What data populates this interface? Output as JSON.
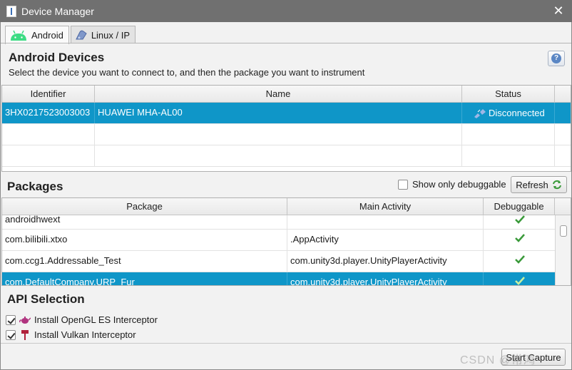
{
  "window": {
    "title": "Device Manager",
    "close_symbol": "✕"
  },
  "tabs": [
    {
      "label": "Android",
      "icon": "android-icon"
    },
    {
      "label": "Linux / IP",
      "icon": "linux-ip-icon"
    }
  ],
  "devices": {
    "title": "Android Devices",
    "subtitle": "Select the device you want to connect to, and then the package you want to instrument",
    "help_label": "?",
    "columns": [
      "Identifier",
      "Name",
      "Status"
    ],
    "rows": [
      {
        "identifier": "3HX0217523003003",
        "name": "HUAWEI MHA-AL00",
        "status": "Disconnected"
      }
    ]
  },
  "packages": {
    "title": "Packages",
    "show_debuggable_label": "Show only debuggable",
    "show_debuggable_checked": false,
    "refresh_label": "Refresh",
    "columns": [
      "Package",
      "Main Activity",
      "Debuggable"
    ],
    "rows": [
      {
        "package": "androidhwext",
        "activity": "",
        "debuggable": true
      },
      {
        "package": "com.bilibili.xtxo",
        "activity": ".AppActivity",
        "debuggable": true
      },
      {
        "package": "com.ccg1.Addressable_Test",
        "activity": "com.unity3d.player.UnityPlayerActivity",
        "debuggable": true
      },
      {
        "package": "com.DefaultCompany.URP_Fur",
        "activity": "com.unity3d.player.UnityPlayerActivity",
        "debuggable": true
      }
    ]
  },
  "api": {
    "title": "API Selection",
    "options": [
      {
        "label": "Install OpenGL ES Interceptor",
        "checked": true,
        "icon": "teapot-icon"
      },
      {
        "label": "Install Vulkan Interceptor",
        "checked": true,
        "icon": "hammer-icon"
      }
    ]
  },
  "footer": {
    "start_label": "Start Capture",
    "watermark": "CSDN @常鸿"
  },
  "colors": {
    "selection": "#0f96c8",
    "titlebar": "#707070",
    "check_green": "#3a9a3a"
  }
}
